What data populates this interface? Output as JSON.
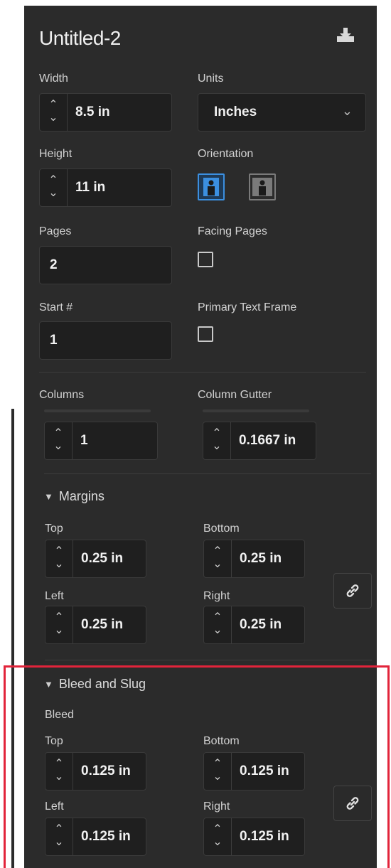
{
  "doc": {
    "title": "Untitled-2"
  },
  "width": {
    "label": "Width",
    "value": "8.5 in"
  },
  "units": {
    "label": "Units",
    "value": "Inches"
  },
  "height": {
    "label": "Height",
    "value": "11 in"
  },
  "orientation": {
    "label": "Orientation",
    "selected": "portrait"
  },
  "pages": {
    "label": "Pages",
    "value": "2"
  },
  "facing": {
    "label": "Facing Pages",
    "checked": false
  },
  "start": {
    "label": "Start #",
    "value": "1"
  },
  "primary": {
    "label": "Primary Text Frame",
    "checked": false
  },
  "columns": {
    "label": "Columns",
    "value": "1"
  },
  "gutter": {
    "label": "Column Gutter",
    "value": "0.1667 in"
  },
  "margins": {
    "title": "Margins",
    "top": {
      "label": "Top",
      "value": "0.25 in"
    },
    "bottom": {
      "label": "Bottom",
      "value": "0.25 in"
    },
    "left": {
      "label": "Left",
      "value": "0.25 in"
    },
    "right": {
      "label": "Right",
      "value": "0.25 in"
    }
  },
  "bleed_slug": {
    "title": "Bleed and Slug",
    "bleed_label": "Bleed",
    "top": {
      "label": "Top",
      "value": "0.125 in"
    },
    "bottom": {
      "label": "Bottom",
      "value": "0.125 in"
    },
    "left": {
      "label": "Left",
      "value": "0.125 in"
    },
    "right": {
      "label": "Right",
      "value": "0.125 in"
    }
  },
  "colors": {
    "accent": "#3b8fe0",
    "panel": "#2b2b2b",
    "highlight": "#e2243b"
  }
}
